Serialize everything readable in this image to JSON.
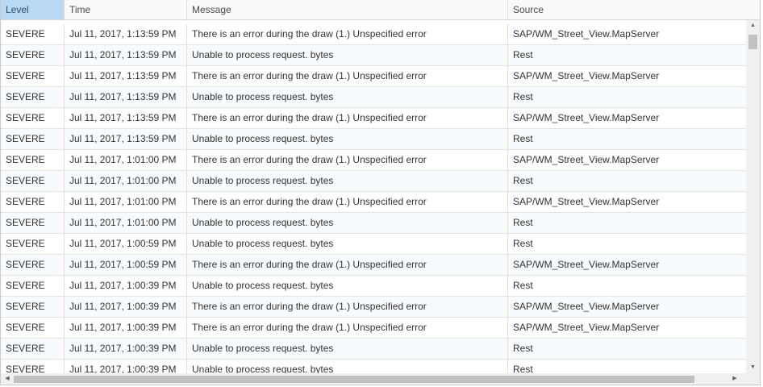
{
  "columns": [
    {
      "key": "level",
      "label": "Level",
      "sorted": true
    },
    {
      "key": "time",
      "label": "Time",
      "sorted": false
    },
    {
      "key": "message",
      "label": "Message",
      "sorted": false
    },
    {
      "key": "source",
      "label": "Source",
      "sorted": false
    }
  ],
  "rows": [
    {
      "level": "SEVERE",
      "time": "Jul 11, 2017, 1:13:59 PM",
      "message": "There is an error during the draw (1.) Unspecified error",
      "source": "SAP/WM_Street_View.MapServer"
    },
    {
      "level": "SEVERE",
      "time": "Jul 11, 2017, 1:13:59 PM",
      "message": "Unable to process request. bytes",
      "source": "Rest"
    },
    {
      "level": "SEVERE",
      "time": "Jul 11, 2017, 1:13:59 PM",
      "message": "There is an error during the draw (1.) Unspecified error",
      "source": "SAP/WM_Street_View.MapServer"
    },
    {
      "level": "SEVERE",
      "time": "Jul 11, 2017, 1:13:59 PM",
      "message": "Unable to process request. bytes",
      "source": "Rest"
    },
    {
      "level": "SEVERE",
      "time": "Jul 11, 2017, 1:13:59 PM",
      "message": "There is an error during the draw (1.) Unspecified error",
      "source": "SAP/WM_Street_View.MapServer"
    },
    {
      "level": "SEVERE",
      "time": "Jul 11, 2017, 1:13:59 PM",
      "message": "Unable to process request. bytes",
      "source": "Rest"
    },
    {
      "level": "SEVERE",
      "time": "Jul 11, 2017, 1:01:00 PM",
      "message": "There is an error during the draw (1.) Unspecified error",
      "source": "SAP/WM_Street_View.MapServer"
    },
    {
      "level": "SEVERE",
      "time": "Jul 11, 2017, 1:01:00 PM",
      "message": "Unable to process request. bytes",
      "source": "Rest"
    },
    {
      "level": "SEVERE",
      "time": "Jul 11, 2017, 1:01:00 PM",
      "message": "There is an error during the draw (1.) Unspecified error",
      "source": "SAP/WM_Street_View.MapServer"
    },
    {
      "level": "SEVERE",
      "time": "Jul 11, 2017, 1:01:00 PM",
      "message": "Unable to process request. bytes",
      "source": "Rest"
    },
    {
      "level": "SEVERE",
      "time": "Jul 11, 2017, 1:00:59 PM",
      "message": "Unable to process request. bytes",
      "source": "Rest"
    },
    {
      "level": "SEVERE",
      "time": "Jul 11, 2017, 1:00:59 PM",
      "message": "There is an error during the draw (1.) Unspecified error",
      "source": "SAP/WM_Street_View.MapServer"
    },
    {
      "level": "SEVERE",
      "time": "Jul 11, 2017, 1:00:39 PM",
      "message": "Unable to process request. bytes",
      "source": "Rest"
    },
    {
      "level": "SEVERE",
      "time": "Jul 11, 2017, 1:00:39 PM",
      "message": "There is an error during the draw (1.) Unspecified error",
      "source": "SAP/WM_Street_View.MapServer"
    },
    {
      "level": "SEVERE",
      "time": "Jul 11, 2017, 1:00:39 PM",
      "message": "There is an error during the draw (1.) Unspecified error",
      "source": "SAP/WM_Street_View.MapServer"
    },
    {
      "level": "SEVERE",
      "time": "Jul 11, 2017, 1:00:39 PM",
      "message": "Unable to process request. bytes",
      "source": "Rest"
    },
    {
      "level": "SEVERE",
      "time": "Jul 11, 2017, 1:00:39 PM",
      "message": "Unable to process request. bytes",
      "source": "Rest"
    }
  ],
  "scrollbars": {
    "up_icon": "arrow-up-icon",
    "down_icon": "arrow-down-icon",
    "left_icon": "arrow-left-icon",
    "right_icon": "arrow-right-icon"
  },
  "colors": {
    "sorted_header_bg": "#b8d8f3",
    "row_alt_bg": "#f7fbfe",
    "column_divider": "#ecdcc8"
  }
}
